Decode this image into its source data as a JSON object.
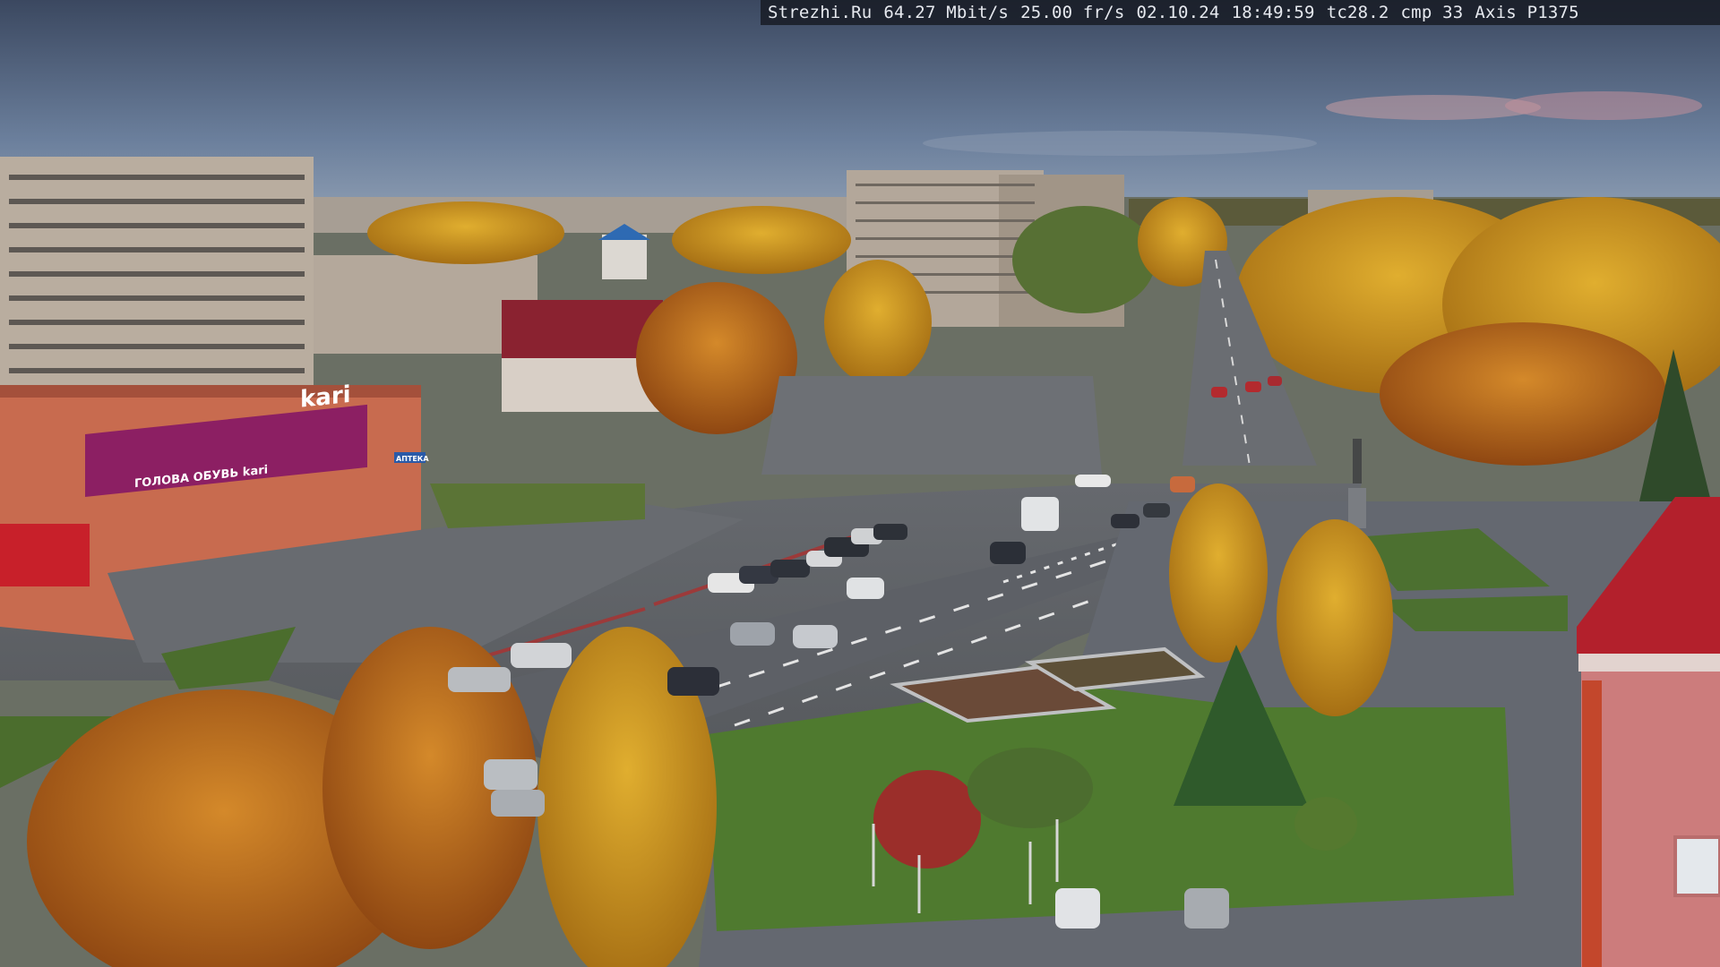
{
  "overlay": {
    "site": "Strezhi.Ru",
    "bitrate": "64.27 Mbit/s",
    "framerate": "25.00 fr/s",
    "date": "02.10.24",
    "time": "18:49:59",
    "tc": "tc28.2",
    "cmp": "cmp 33",
    "camera": "Axis P1375"
  },
  "signs": {
    "store_logo": "kari",
    "store_banner": "ГОЛОВА ОБУВЬ kari",
    "pharmacy": "АПТЕКА"
  },
  "colors": {
    "sky_top": "#3d4a62",
    "sky_bottom": "#7e93ad",
    "foliage_gold": "#c9931e",
    "foliage_orange": "#b8651a",
    "asphalt": "#5a5e64",
    "grass": "#4f7a2f",
    "kari_banner": "#8c1f63",
    "roof_red": "#b3202c"
  }
}
